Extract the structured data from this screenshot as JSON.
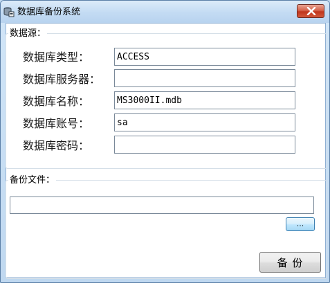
{
  "window": {
    "title": "数据库备份系统"
  },
  "datasource": {
    "legend": "数据源：",
    "fields": [
      {
        "label": "数据库类型：",
        "value": "ACCESS"
      },
      {
        "label": "数据库服务器：",
        "value": ""
      },
      {
        "label": "数据库名称：",
        "value": "MS3000II.mdb"
      },
      {
        "label": "数据库账号：",
        "value": "sa"
      },
      {
        "label": "数据库密码：",
        "value": ""
      }
    ]
  },
  "backup": {
    "legend": "备份文件：",
    "path_value": "",
    "browse_label": "...",
    "backup_button_label": "备 份"
  },
  "colors": {
    "close": "#c0351c",
    "accent": "#3c7fb1"
  }
}
